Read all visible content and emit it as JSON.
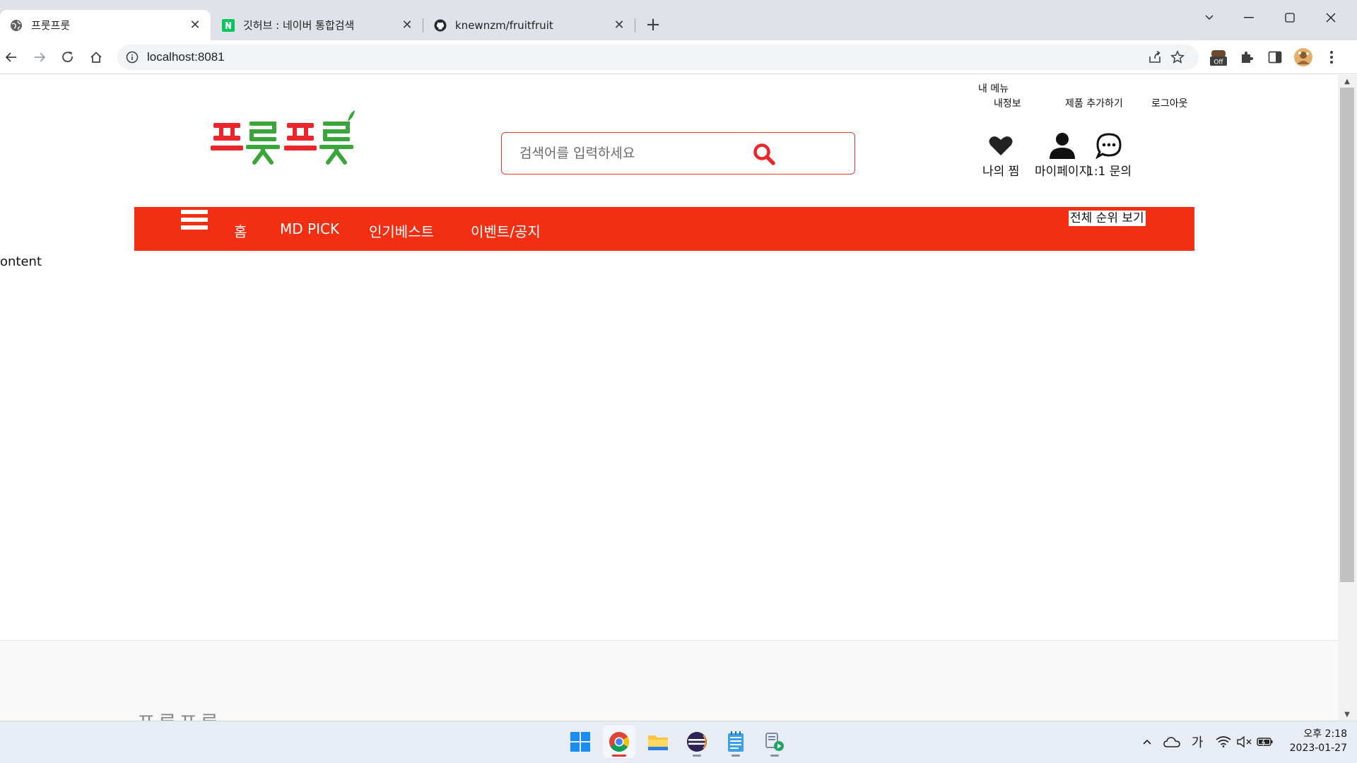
{
  "browser": {
    "tabs": [
      {
        "title": "프룻프룻",
        "active": true
      },
      {
        "title": "깃허브 : 네이버 통합검색",
        "active": false
      },
      {
        "title": "knewnzm/fruitfruit",
        "active": false
      }
    ],
    "url": "localhost:8081",
    "extension_badge": "Off"
  },
  "site": {
    "my_menu_label": "내 메뉴",
    "top_links": [
      "내정보",
      "제품 추가하기",
      "로그아웃"
    ],
    "logo_text": "프룻프룻",
    "search_placeholder": "검색어를 입력하세요",
    "header_icons": [
      {
        "label": "나의 찜",
        "icon": "heart-icon"
      },
      {
        "label": "마이페이지",
        "icon": "user-icon"
      },
      {
        "label": "1:1 문의",
        "icon": "chat-icon"
      }
    ],
    "nav": [
      "홈",
      "MD PICK",
      "인기베스트",
      "이벤트/공지"
    ],
    "rank_button": "전체 순위 보기",
    "content_text": "ontent",
    "footer_logo": "프룻프룻",
    "colors": {
      "brand_red": "#f22f12",
      "logo_red": "#e8262b",
      "logo_green": "#3aa63a"
    }
  },
  "taskbar": {
    "apps": [
      "windows-start",
      "chrome",
      "file-explorer",
      "eclipse",
      "notepad",
      "media-app"
    ],
    "ime": "가",
    "time": "오후 2:18",
    "date": "2023-01-27"
  }
}
